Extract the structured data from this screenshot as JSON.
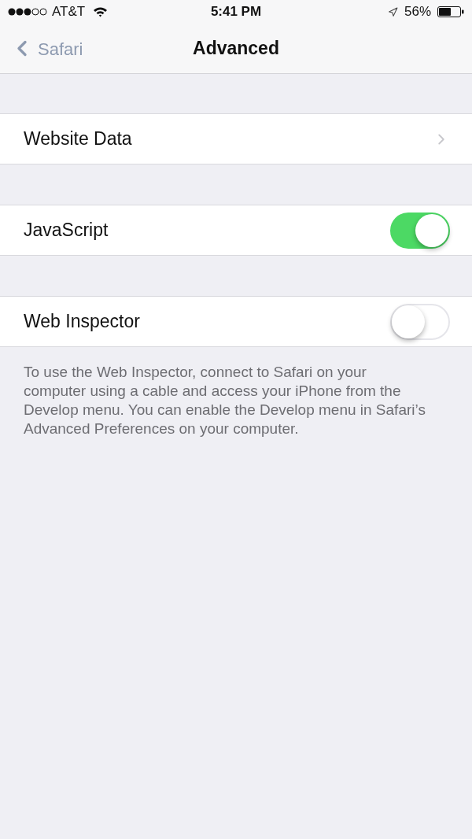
{
  "status_bar": {
    "carrier": "AT&T",
    "time": "5:41 PM",
    "battery": "56%"
  },
  "nav_bar": {
    "back": "Safari",
    "title": "Advanced"
  },
  "sections": [
    {
      "rows": [
        {
          "kind": "disclosure",
          "label": "Website Data"
        }
      ]
    },
    {
      "rows": [
        {
          "kind": "toggle",
          "label": "JavaScript",
          "on": true
        }
      ]
    },
    {
      "rows": [
        {
          "kind": "toggle",
          "label": "Web Inspector",
          "on": false
        }
      ],
      "footer": "To use the Web Inspector, connect to Safari on your computer using a cable and access your iPhone from the Develop menu. You can enable the Develop menu in Safari’s Advanced Preferences on your computer."
    }
  ]
}
